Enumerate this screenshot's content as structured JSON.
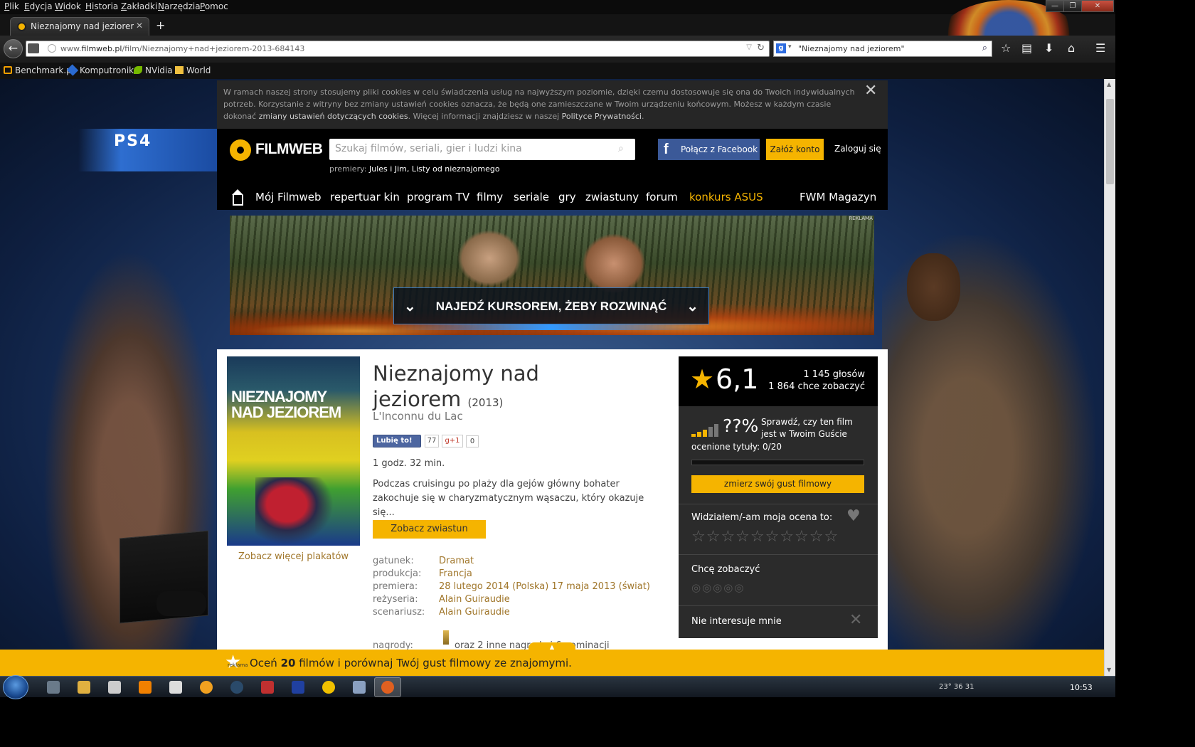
{
  "browser": {
    "menu": [
      "Plik",
      "Edycja",
      "Widok",
      "Historia",
      "Zakładki",
      "Narzędzia",
      "Pomoc"
    ],
    "tab_title": "Nieznajomy nad jeziorem (...",
    "url_prefix": "www.",
    "url_domain": "filmweb.pl",
    "url_path": "/film/Nieznajomy+nad+jeziorem-2013-684143",
    "search_value": "\"Nieznajomy nad jeziorem\"",
    "bookmarks": [
      "Benchmark.pl",
      "Komputronik",
      "NVidia",
      "World"
    ]
  },
  "cookie": {
    "text_a": "W ramach naszej strony stosujemy pliki cookies w celu świadczenia usług na najwyższym poziomie, dzięki czemu dostosowuje się ona do Twoich indywidualnych potrzeb. Korzystanie z witryny bez zmiany ustawień cookies oznacza, że będą one zamieszczane w Twoim urządzeniu końcowym. Możesz w każdym czasie dokonać ",
    "link_a": "zmiany ustawień dotyczących cookies",
    "text_b": ". Więcej informacji znajdziesz w naszej ",
    "link_b": "Polityce Prywatności",
    "text_c": "."
  },
  "header": {
    "logo": "FILMWEB",
    "search_placeholder": "Szukaj filmów, seriali, gier i ludzi kina",
    "premiery_label": "premiery:",
    "premiery_1": "Jules i Jim",
    "premiery_sep": ",",
    "premiery_2": "Listy od nieznajomego",
    "fb_connect": "Połącz z Facebook",
    "register": "Załóż konto",
    "login": "Zaloguj się"
  },
  "nav": [
    "Mój Filmweb",
    "repertuar kin",
    "program TV",
    "filmy",
    "seriale",
    "gry",
    "zwiastuny",
    "forum",
    "konkurs ASUS",
    "FWM Magazyn"
  ],
  "banner": {
    "tag": "REKLAMA",
    "cta": "NAJEDŹ KURSOREM, ŻEBY ROZWINĄĆ"
  },
  "bg_ad": {
    "logo": "PS4"
  },
  "film": {
    "poster_title": "NIEZNAJOMY NAD JEZIOREM",
    "poster_more": "Zobacz więcej plakatów",
    "title": "Nieznajomy nad jeziorem",
    "year": "(2013)",
    "original_title": "L'Inconnu du Lac",
    "fb_like": "Lubię to!",
    "fb_count": "77",
    "gplus": "g+1",
    "gplus_count": "0",
    "duration": "1 godz. 32 min.",
    "description": "Podczas cruisingu po plaży dla gejów główny bohater zakochuje się w charyzmatycznym wąsaczu, który okazuje się...",
    "trailer_button": "Zobacz zwiastun",
    "meta": [
      {
        "key": "gatunek:",
        "value": "Dramat"
      },
      {
        "key": "produkcja:",
        "value": "Francja"
      },
      {
        "key": "premiera:",
        "value": "28 lutego 2014 (Polska) 17 maja 2013 (świat)"
      },
      {
        "key": "reżyseria:",
        "value": "Alain Guiraudie"
      },
      {
        "key": "scenariusz:",
        "value": "Alain Guiraudie"
      }
    ],
    "awards_key": "nagrody:",
    "awards_value": "oraz 2 inne nagrody i 6 nominacji"
  },
  "rating": {
    "value": "6,1",
    "votes": "1 145 głosów",
    "want": "1 864 chce zobaczyć",
    "match_pct": "??%",
    "match_text": "Sprawdź, czy ten film jest w Twoim Guście",
    "rated": "ocenione tytuły: 0/20",
    "match_progress": 0,
    "taste_button": "zmierz swój gust filmowy",
    "seen_label": "Widziałem/-am moja ocena to:",
    "want_label": "Chcę zobaczyć",
    "not_interested": "Nie interesuje mnie"
  },
  "bottom_bar": {
    "ad_tag": "reklama",
    "text_a": "Oceń ",
    "count": "20",
    "text_b": " filmów i porównaj Twój gust filmowy ze znajomymi."
  },
  "taskbar": {
    "tray": "23°  36  31",
    "clock": "10:53"
  },
  "colors": {
    "accent": "#f5b400",
    "link": "#a0762a",
    "facebook": "#3b5998",
    "header_bg": "#000000"
  }
}
